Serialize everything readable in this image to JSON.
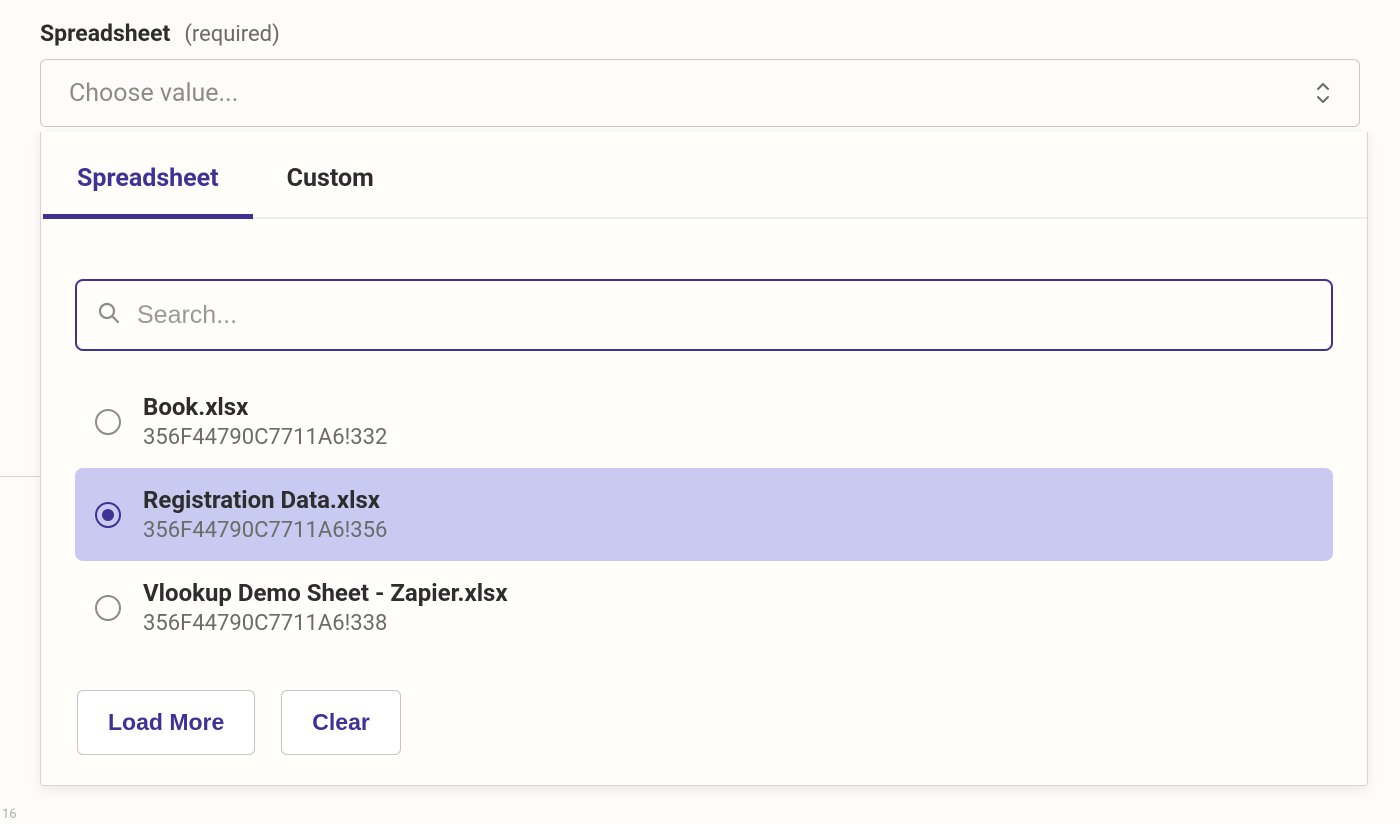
{
  "field": {
    "label": "Spreadsheet",
    "required_text": "(required)"
  },
  "select": {
    "placeholder": "Choose value..."
  },
  "tabs": {
    "spreadsheet": "Spreadsheet",
    "custom": "Custom"
  },
  "search": {
    "placeholder": "Search..."
  },
  "options": [
    {
      "name": "Book.xlsx",
      "id": "356F44790C7711A6!332",
      "selected": false
    },
    {
      "name": "Registration Data.xlsx",
      "id": "356F44790C7711A6!356",
      "selected": true
    },
    {
      "name": "Vlookup Demo Sheet -  Zapier.xlsx",
      "id": "356F44790C7711A6!338",
      "selected": false
    }
  ],
  "actions": {
    "load_more": "Load More",
    "clear": "Clear"
  },
  "corner": "16"
}
